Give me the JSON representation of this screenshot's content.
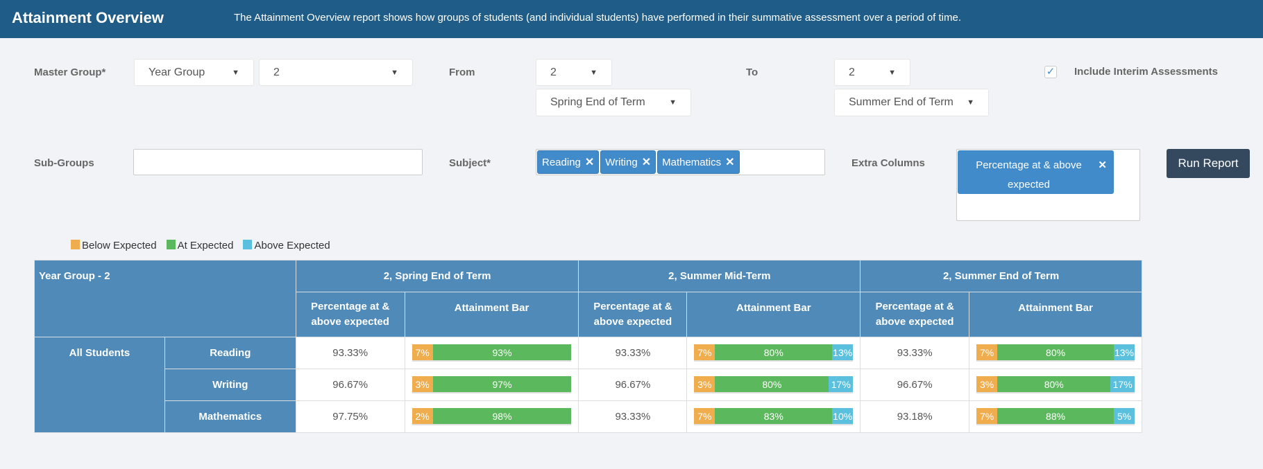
{
  "header": {
    "title": "Attainment Overview",
    "description": "The Attainment Overview report shows how groups of students (and individual students) have performed in their summative assessment over a period of time."
  },
  "form": {
    "master_group_label": "Master Group*",
    "master_group_type": "Year Group",
    "master_group_value": "2",
    "from_label": "From",
    "from_year": "2",
    "from_term": "Spring End of Term",
    "to_label": "To",
    "to_year": "2",
    "to_term": "Summer End of Term",
    "include_interim_label": "Include Interim Assessments",
    "include_interim_checked": true,
    "sub_groups_label": "Sub-Groups",
    "sub_groups_value": "",
    "subject_label": "Subject*",
    "subjects": [
      "Reading",
      "Writing",
      "Mathematics"
    ],
    "extra_columns_label": "Extra Columns",
    "extra_columns": [
      "Percentage at & above expected"
    ],
    "run_report_label": "Run Report",
    "remove_icon": "✕"
  },
  "legend": [
    {
      "label": "Below Expected",
      "color": "#f0ad4e"
    },
    {
      "label": "At Expected",
      "color": "#5cb85c"
    },
    {
      "label": "Above Expected",
      "color": "#5bc0de"
    }
  ],
  "table": {
    "group_header": "Year Group - 2",
    "sub_header_pct": "Percentage at & above expected",
    "sub_header_bar": "Attainment Bar",
    "terms": [
      "2, Spring End of Term",
      "2, Summer Mid-Term",
      "2, Summer End of Term"
    ],
    "group": "All Students",
    "rows": [
      {
        "subject": "Reading",
        "cells": [
          {
            "pct": "93.33%",
            "bar": [
              7,
              93,
              0
            ]
          },
          {
            "pct": "93.33%",
            "bar": [
              7,
              80,
              13
            ]
          },
          {
            "pct": "93.33%",
            "bar": [
              7,
              80,
              13
            ]
          }
        ]
      },
      {
        "subject": "Writing",
        "cells": [
          {
            "pct": "96.67%",
            "bar": [
              3,
              97,
              0
            ]
          },
          {
            "pct": "96.67%",
            "bar": [
              3,
              80,
              17
            ]
          },
          {
            "pct": "96.67%",
            "bar": [
              3,
              80,
              17
            ]
          }
        ]
      },
      {
        "subject": "Mathematics",
        "cells": [
          {
            "pct": "97.75%",
            "bar": [
              2,
              98,
              0
            ]
          },
          {
            "pct": "93.33%",
            "bar": [
              7,
              83,
              10
            ]
          },
          {
            "pct": "93.18%",
            "bar": [
              7,
              88,
              5
            ]
          }
        ]
      }
    ]
  }
}
